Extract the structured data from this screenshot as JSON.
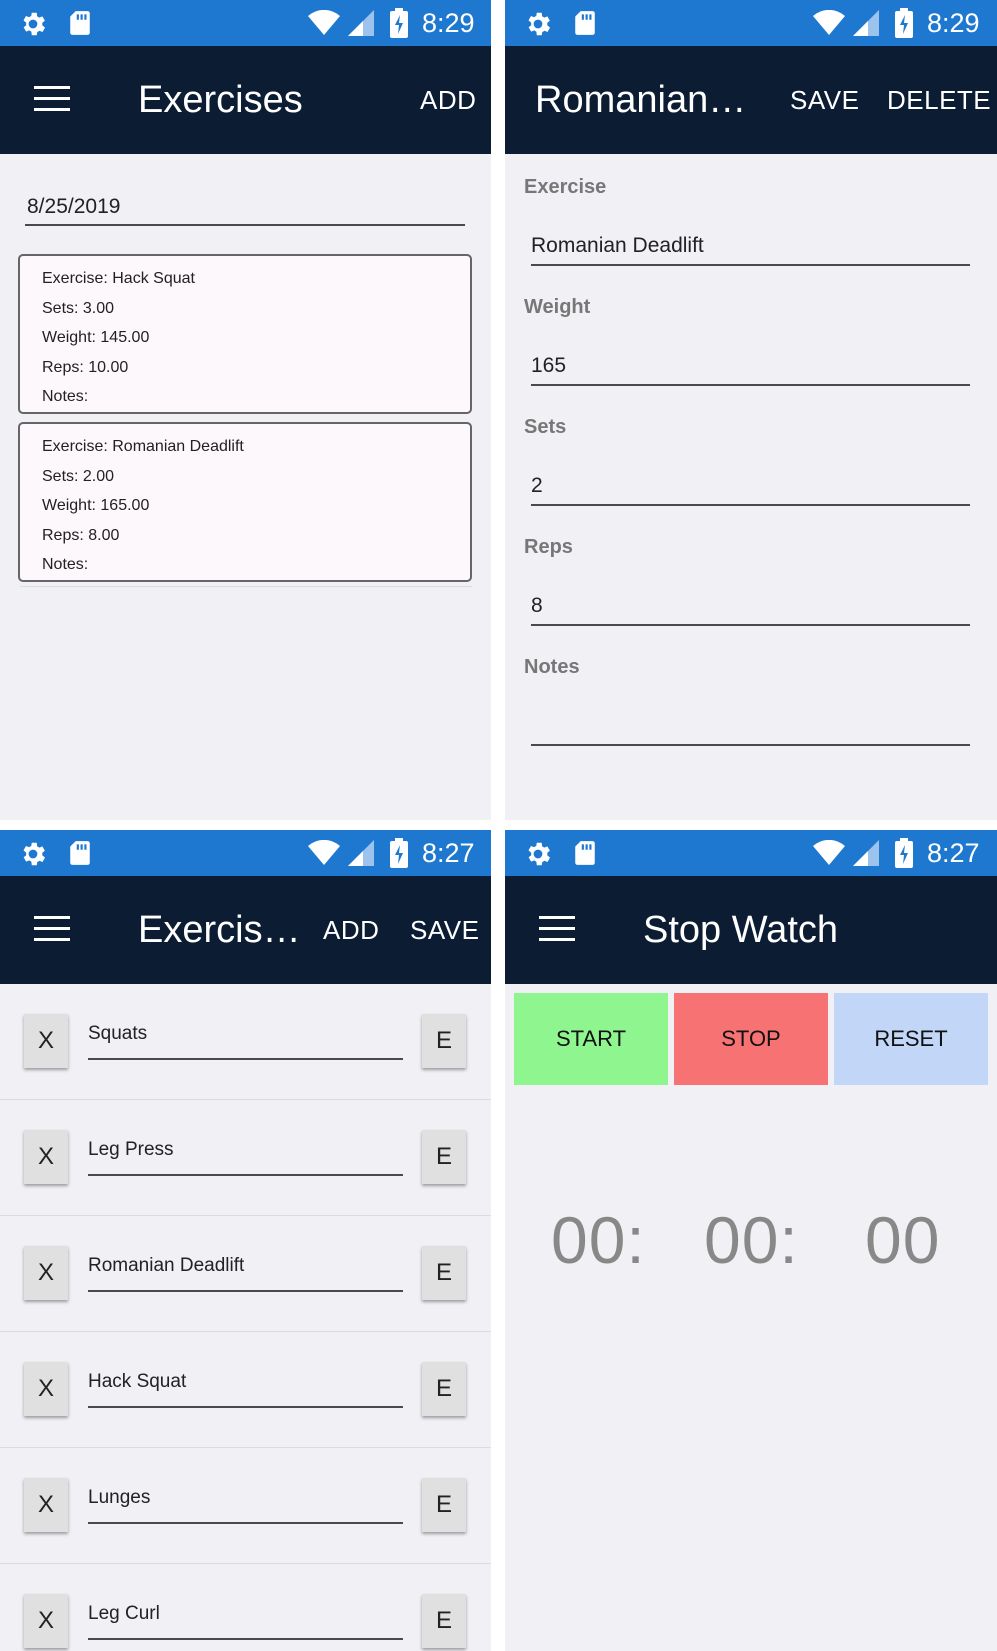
{
  "status_bars": [
    {
      "time": "8:29"
    },
    {
      "time": "8:29"
    },
    {
      "time": "8:27"
    },
    {
      "time": "8:27"
    }
  ],
  "screen1": {
    "title": "Exercises",
    "add_label": "ADD",
    "date": "8/25/2019",
    "cards": [
      {
        "exercise": "Exercise: Hack Squat",
        "sets": "Sets: 3.00",
        "weight": "Weight: 145.00",
        "reps": "Reps: 10.00",
        "notes": "Notes:"
      },
      {
        "exercise": "Exercise: Romanian Deadlift",
        "sets": "Sets: 2.00",
        "weight": "Weight: 165.00",
        "reps": "Reps: 8.00",
        "notes": "Notes:"
      }
    ]
  },
  "screen2": {
    "title": "Romanian…",
    "save_label": "SAVE",
    "delete_label": "DELETE",
    "fields": [
      {
        "label": "Exercise",
        "value": "Romanian Deadlift"
      },
      {
        "label": "Weight",
        "value": "165"
      },
      {
        "label": "Sets",
        "value": "2"
      },
      {
        "label": "Reps",
        "value": "8"
      },
      {
        "label": "Notes",
        "value": ""
      }
    ]
  },
  "screen3": {
    "title": "Exercis…",
    "add_label": "ADD",
    "save_label": "SAVE",
    "delete_label": "X",
    "edit_label": "E",
    "exercises": [
      "Squats",
      "Leg Press",
      "Romanian Deadlift",
      "Hack Squat",
      "Lunges",
      "Leg Curl"
    ]
  },
  "screen4": {
    "title": "Stop Watch",
    "start_label": "START",
    "stop_label": "STOP",
    "reset_label": "RESET",
    "hours": "00:",
    "minutes": "00:",
    "seconds": "00"
  },
  "colors": {
    "status_bar": "#1e78d0",
    "toolbar": "#0c1d33",
    "background": "#f0f0f5",
    "start_button": "#8ff58f",
    "stop_button": "#f77272",
    "reset_button": "#c2d7f7"
  }
}
